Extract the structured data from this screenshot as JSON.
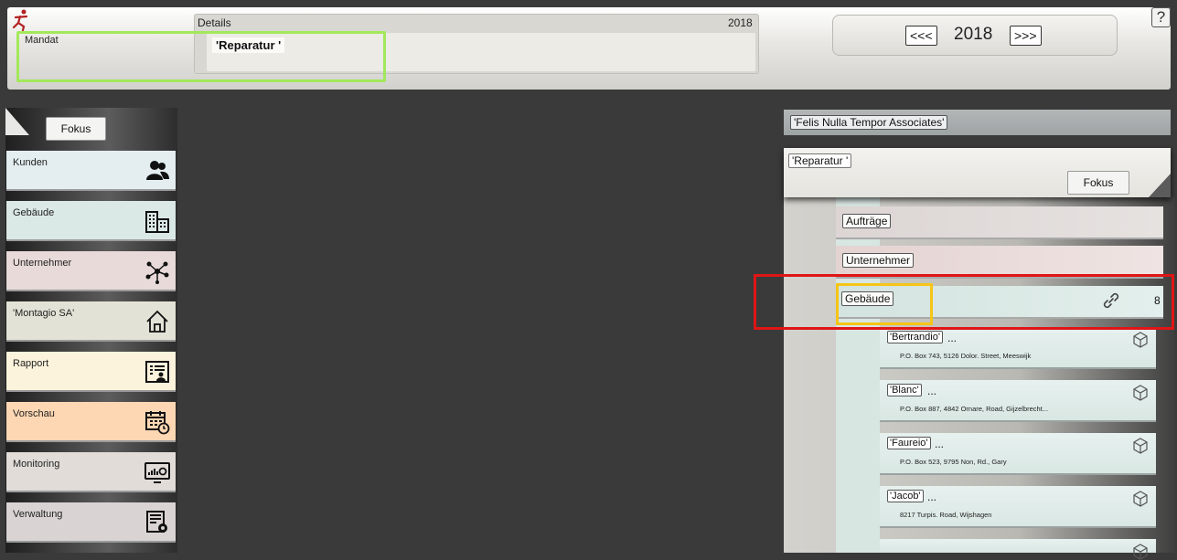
{
  "header": {
    "mandat_label": "Mandat",
    "details_title": "Details",
    "details_year": "2018",
    "details_value": "'Reparatur '",
    "year_nav": {
      "prev": "<<<",
      "year": "2018",
      "next": ">>>"
    },
    "help": "?"
  },
  "sidebar": {
    "fokus": "Fokus",
    "items": [
      {
        "label": "Kunden",
        "icon": "people-icon",
        "color": "#e4eef0"
      },
      {
        "label": "Gebäude",
        "icon": "buildings-icon",
        "color": "#dbe9e6"
      },
      {
        "label": "Unternehmer",
        "icon": "network-icon",
        "color": "#e7dad8"
      },
      {
        "label": "'Montagio SA'",
        "icon": "house-icon",
        "color": "#e3e2d6"
      },
      {
        "label": "Rapport",
        "icon": "report-icon",
        "color": "#fcf3dc"
      },
      {
        "label": "Vorschau",
        "icon": "calendar-icon",
        "color": "#fdd7b3"
      },
      {
        "label": "Monitoring",
        "icon": "monitor-icon",
        "color": "#e1dcd8"
      },
      {
        "label": "Verwaltung",
        "icon": "settings-doc-icon",
        "color": "#d9d3d4"
      }
    ]
  },
  "right": {
    "client": "'Felis Nulla Tempor Associates'",
    "mandate": "'Reparatur '",
    "fokus": "Fokus",
    "tree": {
      "auftraege": "Aufträge",
      "unternehmer": "Unternehmer",
      "gebaeude": "Gebäude",
      "gebaeude_count": "8"
    },
    "buildings": [
      {
        "name": "'Bertrandio'",
        "dots": "...",
        "address": "P.O. Box 743, 5126 Dolor. Street, Meeswijk"
      },
      {
        "name": "'Blanc'",
        "dots": "...",
        "address": "P.O. Box 887, 4842 Ornare, Road, Gijzelbrecht..."
      },
      {
        "name": "'Faureio'",
        "dots": "...",
        "address": "P.O. Box 523, 9795 Non, Rd., Gary"
      },
      {
        "name": "'Jacob'",
        "dots": "...",
        "address": "8217 Turpis. Road, Wijshagen"
      }
    ]
  }
}
